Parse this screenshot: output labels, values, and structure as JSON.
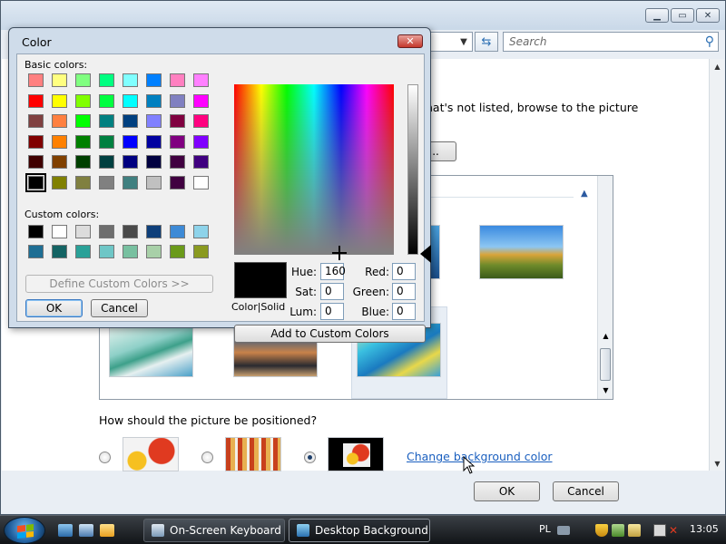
{
  "background_window": {
    "search": {
      "placeholder": "Search"
    },
    "partial_text": "hat's not listed, browse to the picture",
    "browse_button": "e...",
    "position_question": "How should the picture be positioned?",
    "change_bg_link": "Change background color",
    "ok_label": "OK",
    "cancel_label": "Cancel"
  },
  "color_dialog": {
    "title": "Color",
    "basic_colors_label": "Basic colors:",
    "custom_colors_label": "Custom colors:",
    "basic_colors": [
      [
        "#ff8080",
        "#ffff80",
        "#80ff80",
        "#00ff80",
        "#80ffff",
        "#0080ff",
        "#ff80c0",
        "#ff80ff"
      ],
      [
        "#ff0000",
        "#ffff00",
        "#80ff00",
        "#00ff40",
        "#00ffff",
        "#0080c0",
        "#8080c0",
        "#ff00ff"
      ],
      [
        "#804040",
        "#ff8040",
        "#00ff00",
        "#008080",
        "#004080",
        "#8080ff",
        "#800040",
        "#ff0080"
      ],
      [
        "#800000",
        "#ff8000",
        "#008000",
        "#008040",
        "#0000ff",
        "#0000a0",
        "#800080",
        "#8000ff"
      ],
      [
        "#400000",
        "#804000",
        "#004000",
        "#004040",
        "#000080",
        "#000040",
        "#400040",
        "#400080"
      ],
      [
        "#000000",
        "#808000",
        "#808040",
        "#808080",
        "#408080",
        "#c0c0c0",
        "#400040",
        "#ffffff"
      ]
    ],
    "custom_colors": [
      [
        "#000000",
        "#ffffff",
        "#dcdcdc",
        "#6e6e6e",
        "#4a4a4a",
        "#0e3f7a",
        "#3d8ad6",
        "#8ed3ea"
      ],
      [
        "#1e6e94",
        "#146464",
        "#2aa198",
        "#6ec6c6",
        "#78c0a0",
        "#a8d0a8",
        "#6a9a1a",
        "#8a9a20"
      ]
    ],
    "define_custom_label": "Define Custom Colors >>",
    "ok_label": "OK",
    "cancel_label": "Cancel",
    "color_solid_label": "Color|Solid",
    "fields": {
      "hue_label": "Hue:",
      "hue": "160",
      "sat_label": "Sat:",
      "sat": "0",
      "lum_label": "Lum:",
      "lum": "0",
      "red_label": "Red:",
      "red": "0",
      "green_label": "Green:",
      "green": "0",
      "blue_label": "Blue:",
      "blue": "0"
    },
    "add_custom_label": "Add to Custom Colors"
  },
  "taskbar": {
    "buttons": [
      {
        "label": "On-Screen Keyboard"
      },
      {
        "label": "Desktop Background"
      }
    ],
    "language": "PL",
    "clock": "13:05"
  },
  "colors": {
    "link": "#1a5fbf",
    "dialog_frame": "#cfdcea"
  }
}
